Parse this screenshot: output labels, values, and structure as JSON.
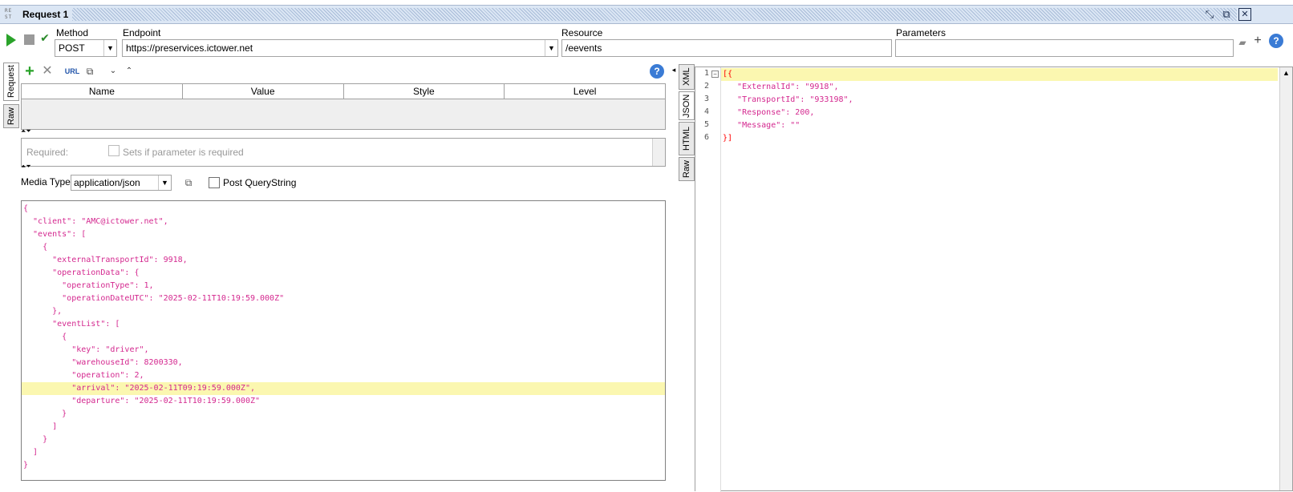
{
  "window": {
    "logo_text": "RE ST",
    "title": "Request 1"
  },
  "toolbar": {
    "method_label": "Method",
    "method_value": "POST",
    "endpoint_label": "Endpoint",
    "endpoint_value": "https://preservices.ictower.net",
    "resource_label": "Resource",
    "resource_value": "/eevents",
    "parameters_label": "Parameters",
    "parameters_value": ""
  },
  "left_tabs": [
    "Request",
    "Raw"
  ],
  "right_tabs": [
    "XML",
    "JSON",
    "HTML",
    "Raw"
  ],
  "params_table": {
    "columns": [
      "Name",
      "Value",
      "Style",
      "Level"
    ]
  },
  "required_panel": {
    "label": "Required:",
    "checkbox_label": "Sets if parameter is required"
  },
  "media": {
    "label": "Media Type",
    "value": "application/json",
    "post_querystring_label": "Post QueryString"
  },
  "request_body": [
    "{",
    "  \"client\": \"AMC@ictower.net\",",
    "  \"events\": [",
    "    {",
    "      \"externalTransportId\": 9918,",
    "      \"operationData\": {",
    "        \"operationType\": 1,",
    "        \"operationDateUTC\": \"2025-02-11T10:19:59.000Z\"",
    "      },",
    "      \"eventList\": [",
    "        {",
    "          \"key\": \"driver\",",
    "          \"warehouseId\": 8200330,",
    "          \"operation\": 2,",
    "          \"arrival\": \"2025-02-11T09:19:59.000Z\",",
    "          \"departure\": \"2025-02-11T10:19:59.000Z\"",
    "        }",
    "      ]",
    "    }",
    "  ]",
    "}"
  ],
  "request_highlight_line": 14,
  "response_body": [
    "[{",
    "   \"ExternalId\": \"9918\",",
    "   \"TransportId\": \"933198\",",
    "   \"Response\": 200,",
    "   \"Message\": \"\"",
    "}]"
  ],
  "response_line_numbers": [
    "1",
    "2",
    "3",
    "4",
    "5",
    "6"
  ],
  "colors": {
    "accent": "#2aa32a",
    "json_key": "#d4288f",
    "json_brace": "#ff0000",
    "highlight": "#fbf7b0"
  }
}
